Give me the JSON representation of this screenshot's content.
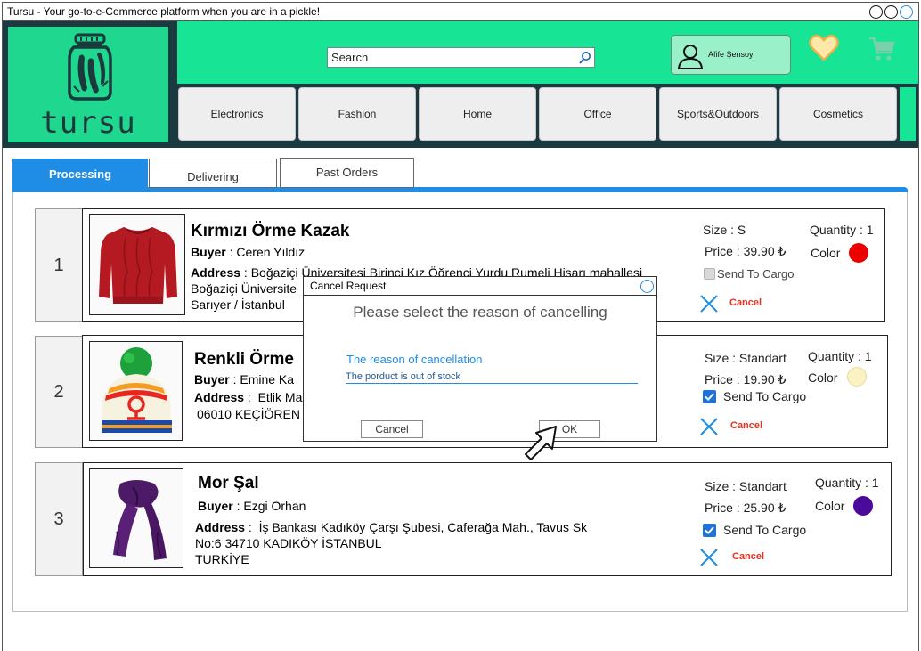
{
  "window": {
    "title": "Tursu - Your go-to-e-Commerce platform when you are in a pickle!"
  },
  "brand": {
    "name": "tursu",
    "primary_color": "#18e496",
    "dark_color": "#1a3a3f",
    "accent_color": "#1f8ce6"
  },
  "header": {
    "search_placeholder": "Search",
    "user_name": "Afife Şensoy",
    "icons": [
      "pickle-jar-logo",
      "search-icon",
      "user-icon",
      "heart-icon",
      "cart-icon"
    ]
  },
  "nav": [
    "Electronics",
    "Fashion",
    "Home",
    "Office",
    "Sports&Outdoors",
    "Cosmetics"
  ],
  "tabs": [
    {
      "label": "Processing",
      "active": true
    },
    {
      "label": "Delivering",
      "active": false
    },
    {
      "label": "Past Orders",
      "active": false
    }
  ],
  "orders": [
    {
      "index": "1",
      "product": "Kırmızı Örme Kazak",
      "buyer_label": "Buyer",
      "buyer": "Ceren Yıldız",
      "address_label": "Address",
      "address_lines": [
        "Boğaziçi Üniversitesi Birinci Kız Öğrenci Yurdu Rumeli Hisarı mahallesi",
        "Boğaziçi Üniversite",
        "Sarıyer / İstanbul"
      ],
      "size": "Size : S",
      "price": "Price : 39.90 ₺",
      "quantity": "Quantity : 1",
      "color_label": "Color",
      "color_hex": "#ee0000",
      "send_label": "Send To Cargo",
      "sent": false,
      "cancel_label": "Cancel"
    },
    {
      "index": "2",
      "product": "Renkli Örme",
      "buyer_label": "Buyer",
      "buyer": "Emine Ka",
      "address_label": "Address",
      "address_lines": [
        "Etlik Ma",
        "06010 KEÇİÖREN"
      ],
      "size": "Size : Standart",
      "price": "Price : 19.90 ₺",
      "quantity": "Quantity : 1",
      "color_label": "Color",
      "color_hex": "#fbf2c3",
      "send_label": "Send To Cargo",
      "sent": true,
      "cancel_label": "Cancel"
    },
    {
      "index": "3",
      "product": "Mor Şal",
      "buyer_label": "Buyer",
      "buyer": "Ezgi Orhan",
      "address_label": "Address",
      "address_lines": [
        "İş Bankası Kadıköy Çarşı Şubesi, Caferağa Mah., Tavus Sk",
        "No:6 34710 KADIKÖY İSTANBUL",
        "TURKİYE"
      ],
      "size": "Size : Standart",
      "price": "Price : 25.90 ₺",
      "quantity": "Quantity : 1",
      "color_label": "Color",
      "color_hex": "#4a0a9a",
      "send_label": "Send To Cargo",
      "sent": true,
      "cancel_label": "Cancel"
    }
  ],
  "dialog": {
    "title": "Cancel Request",
    "heading": "Please select the reason of cancelling",
    "field_label": "The reason of cancellation",
    "field_value": "The porduct is out of stock",
    "cancel_button": "Cancel",
    "ok_button": "OK"
  }
}
